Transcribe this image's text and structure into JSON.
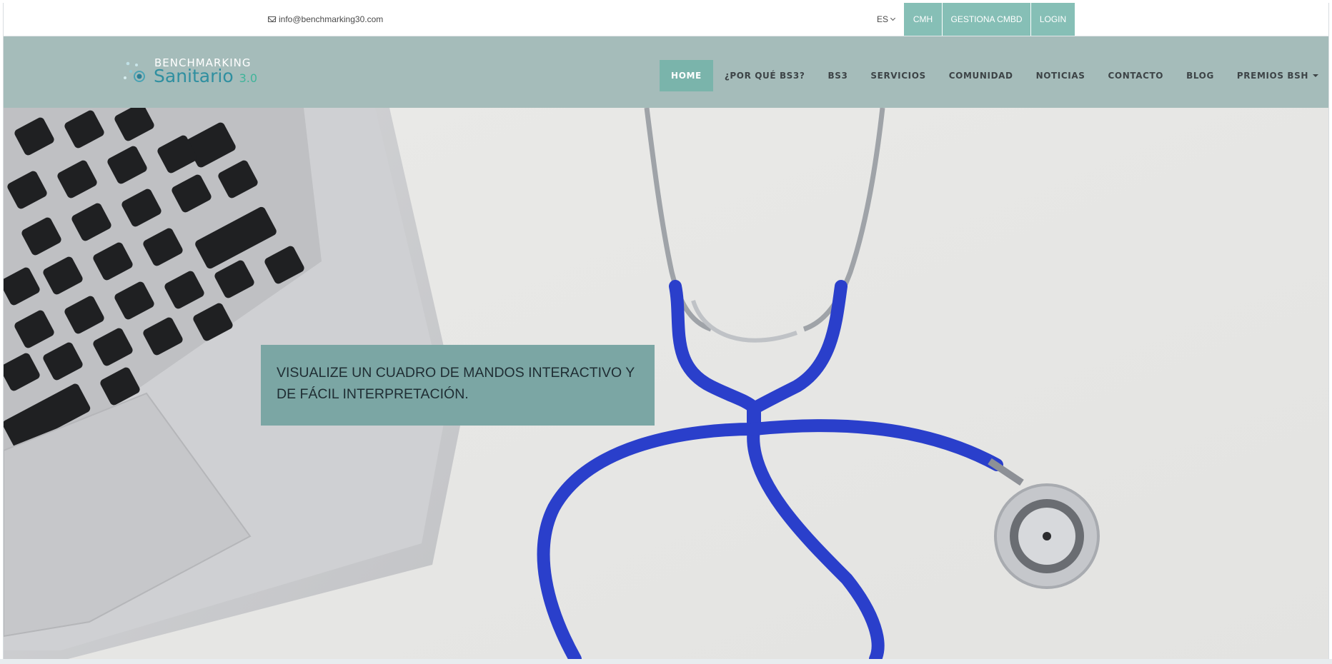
{
  "topbar": {
    "email": "info@benchmarking30.com",
    "email_icon": "envelope-icon",
    "language": "ES",
    "buttons": [
      "CMH",
      "GESTIONA CMBD",
      "LOGIN"
    ],
    "button_color": "#86bfb6"
  },
  "logo": {
    "line1": "BENCHMARKING",
    "line2": "Sanitario",
    "version": "3.0"
  },
  "nav": {
    "items": [
      "HOME",
      "¿POR QUÉ BS3?",
      "BS3",
      "SERVICIOS",
      "COMUNIDAD",
      "NOTICIAS",
      "CONTACTO",
      "BLOG",
      "PREMIOS BSH"
    ],
    "active": "HOME",
    "background": "#a5bcba",
    "active_color": "#7ab4ab"
  },
  "hero": {
    "caption": "VISUALIZE UN CUADRO DE MANDOS INTERACTIVO Y DE FÁCIL INTERPRETACIÓN.",
    "caption_bg": "#7ba6a4",
    "image_subject": "laptop-and-stethoscope-photo"
  }
}
